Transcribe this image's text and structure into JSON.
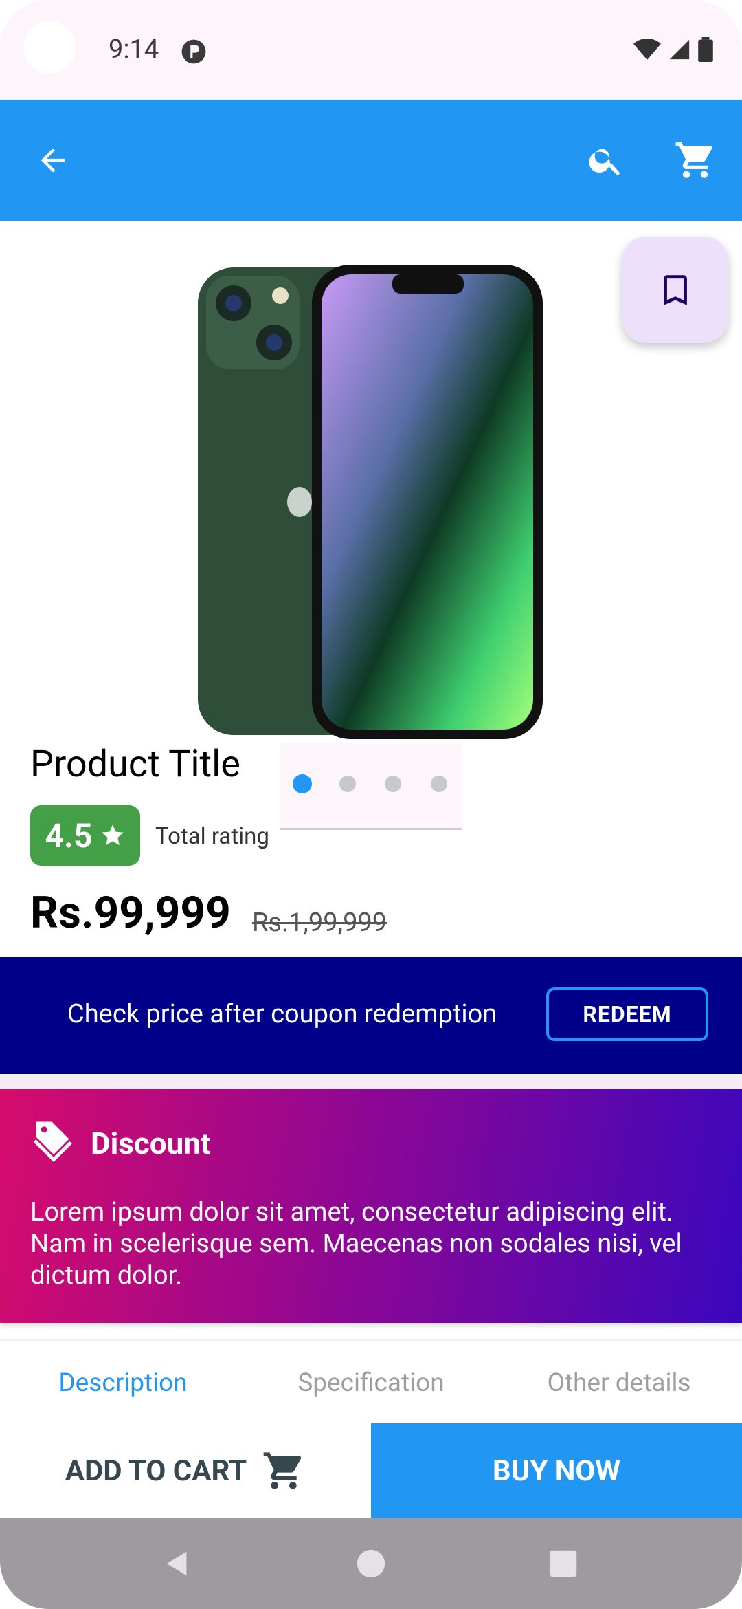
{
  "status_bar": {
    "time": "9:14",
    "icons": [
      "app-notification-icon",
      "wifi-icon",
      "signal-icon",
      "battery-icon"
    ]
  },
  "toolbar": {
    "icons": [
      "back-arrow-icon",
      "search-icon",
      "cart-icon"
    ],
    "color": "#2196f3"
  },
  "product": {
    "title": "Product Title",
    "rating": "4.5",
    "rating_caption": "Total rating",
    "price": "Rs.99,999",
    "mrp": "Rs.1,99,999",
    "image_pager": {
      "count": 4,
      "active_index": 0
    }
  },
  "coupon": {
    "text": "Check price after coupon redemption",
    "button": "REDEEM",
    "bg": "#000088"
  },
  "discount": {
    "title": "Discount",
    "body": "Lorem ipsum dolor sit amet, consectetur adipiscing elit. Nam in scelerisque sem. Maecenas non sodales nisi, vel dictum dolor."
  },
  "tabs": [
    {
      "label": "Description",
      "active": true
    },
    {
      "label": "Specification",
      "active": false
    },
    {
      "label": "Other details",
      "active": false
    }
  ],
  "actions": {
    "add_to_cart": "ADD TO CART",
    "buy_now": "BUY NOW"
  },
  "nav_bar": {
    "icons": [
      "nav-back-icon",
      "nav-home-icon",
      "nav-recents-icon"
    ]
  }
}
